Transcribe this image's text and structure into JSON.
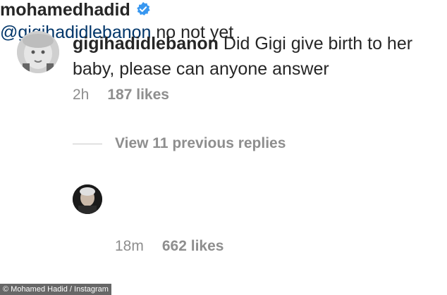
{
  "comment1": {
    "username": "gigihadidlebanon",
    "text": "Did Gigi give birth to her baby, please can anyone answer",
    "time": "2h",
    "likes": "187 likes"
  },
  "view_replies": "View 11 previous replies",
  "comment2": {
    "username": "mohamedhadid",
    "mention": "@gigihadidlebanon",
    "text": "no not yet",
    "time": "18m",
    "likes": "662 likes",
    "verified_icon": "verified-badge-icon"
  },
  "credit": "© Mohamed Hadid / Instagram",
  "colors": {
    "text": "#262626",
    "meta": "#8e8e8e",
    "mention": "#003569",
    "verified": "#3897f0"
  }
}
